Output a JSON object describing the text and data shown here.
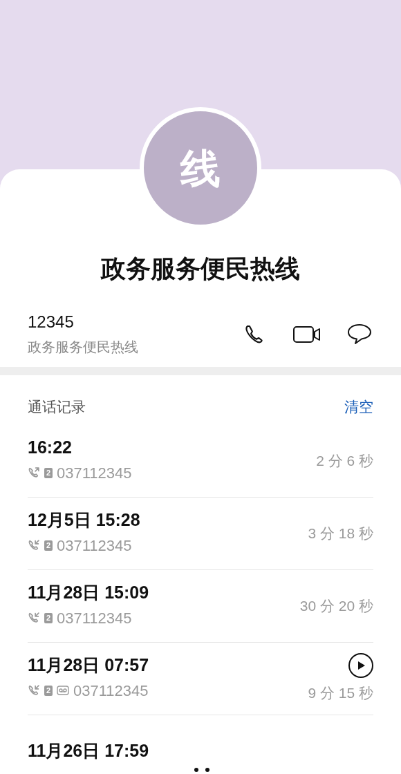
{
  "avatar": {
    "initial": "线"
  },
  "contact": {
    "name": "政务服务便民热线",
    "number": "12345",
    "label": "政务服务便民热线"
  },
  "call_log": {
    "title": "通话记录",
    "clear": "清空",
    "rows": [
      {
        "time": "16:22",
        "kind": "outgoing",
        "sim": "2",
        "voicemail": false,
        "number": "037112345",
        "duration": "2 分 6 秒",
        "playable": false
      },
      {
        "time": "12月5日 15:28",
        "kind": "incoming",
        "sim": "2",
        "voicemail": false,
        "number": "037112345",
        "duration": "3 分 18 秒",
        "playable": false
      },
      {
        "time": "11月28日 15:09",
        "kind": "incoming",
        "sim": "2",
        "voicemail": false,
        "number": "037112345",
        "duration": "30 分 20 秒",
        "playable": false
      },
      {
        "time": "11月28日 07:57",
        "kind": "incoming",
        "sim": "2",
        "voicemail": true,
        "number": "037112345",
        "duration": "9 分 15 秒",
        "playable": true
      },
      {
        "time": "11月26日 17:59"
      }
    ]
  }
}
